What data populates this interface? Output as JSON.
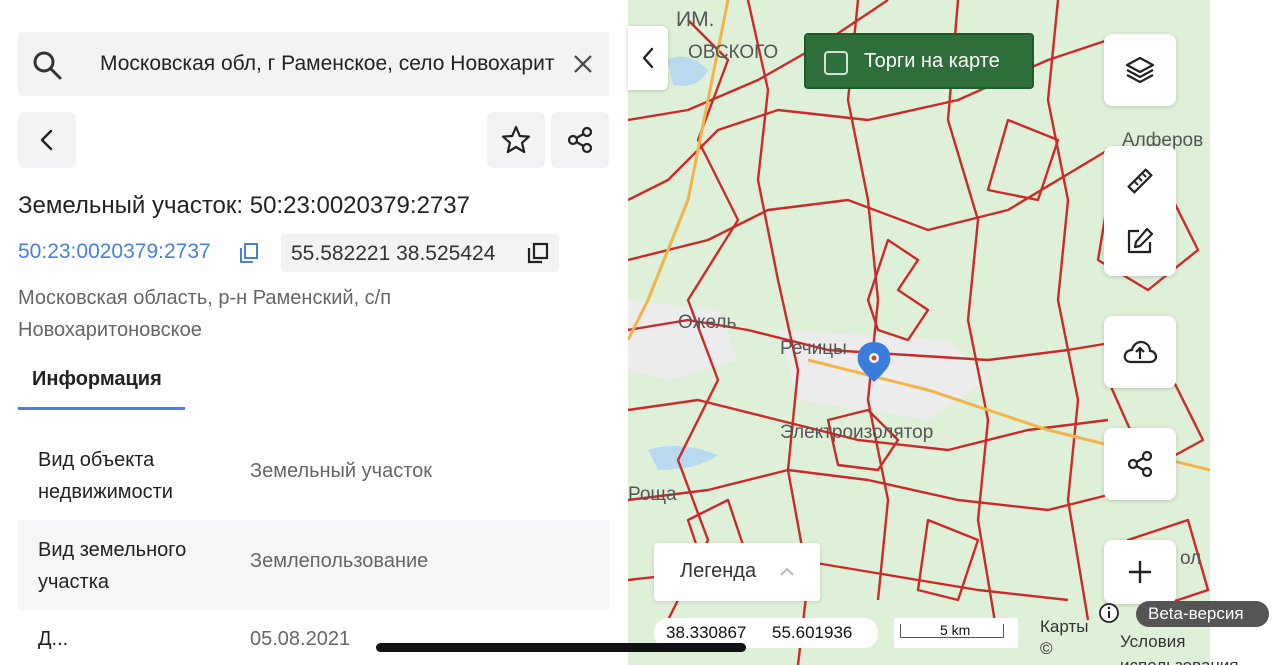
{
  "search": {
    "value": "Московская обл, г Раменское, село Новохарит",
    "icons": {
      "search": "search-icon",
      "clear": "close-icon"
    }
  },
  "toolbar": {
    "back": "chevron-left-icon",
    "favorite": "star-icon",
    "share": "share-icon"
  },
  "object": {
    "title": "Земельный участок: 50:23:0020379:2737",
    "cadastral_number": "50:23:0020379:2737",
    "coordinates": "55.582221 38.525424",
    "address": "Московская область, р-н Раменский, с/п Новохаритоновское"
  },
  "tabs": [
    {
      "label": "Информация",
      "active": true
    }
  ],
  "info_rows": [
    {
      "key": "Вид объекта недвижимости",
      "value": "Земельный участок"
    },
    {
      "key": "Вид земельного участка",
      "value": "Землепользование"
    },
    {
      "key": "Д...",
      "value": "05.08.2021"
    }
  ],
  "map": {
    "labels": {
      "top_left": "ИМ.",
      "top_left2": "ОВСКОГО",
      "alferovo": "Алферов",
      "ikhol": "Ожель",
      "rechitsy": "Речицы",
      "elektroizolyator": "Электроизолятор",
      "roshcha": "Роща",
      "right_edge": "ол"
    },
    "torgi_label": "Торги на карте",
    "legend_label": "Легенда",
    "coords_readout": {
      "lon": "38.330867",
      "lat": "55.601936"
    },
    "scale_label": "5 km",
    "attribution": "Карты ©",
    "beta_label": "Beta-версия",
    "terms_label": "Условия использования",
    "colors": {
      "parcel_lines": "#cc2a2a",
      "map_bg": "#dff0d8",
      "marker": "#3b7ddd",
      "torgi_bg": "#2e6e3a"
    }
  }
}
